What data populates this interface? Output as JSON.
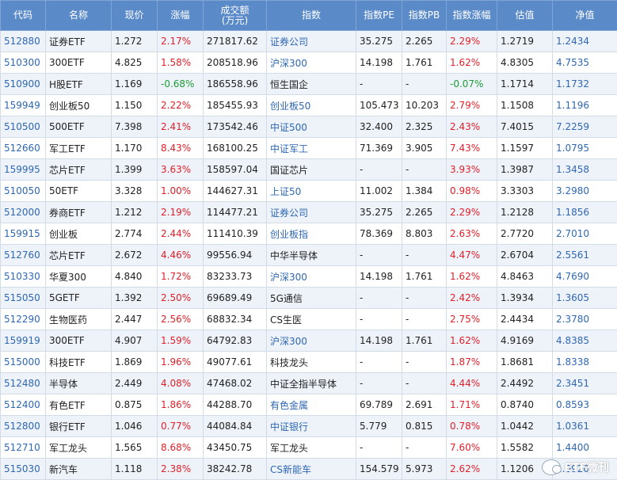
{
  "header": {
    "code": "代码",
    "name": "名称",
    "price": "现价",
    "change": "涨幅",
    "volume_line1": "成交额",
    "volume_line2": "(万元)",
    "index": "指数",
    "pe": "指数PE",
    "pb": "指数PB",
    "index_change": "指数涨幅",
    "estimate": "估值",
    "nav": "净值"
  },
  "rows": [
    {
      "code": "512880",
      "name": "证券ETF",
      "price": "1.272",
      "change": "2.17%",
      "dir": "up",
      "volume": "271817.62",
      "index": "证券公司",
      "index_link": true,
      "pe": "35.275",
      "pb": "2.265",
      "index_change": "2.29%",
      "index_dir": "up",
      "estimate": "1.2719",
      "nav": "1.2434"
    },
    {
      "code": "510300",
      "name": "300ETF",
      "price": "4.825",
      "change": "1.58%",
      "dir": "up",
      "volume": "208518.96",
      "index": "沪深300",
      "index_link": true,
      "pe": "14.198",
      "pb": "1.761",
      "index_change": "1.62%",
      "index_dir": "up",
      "estimate": "4.8305",
      "nav": "4.7535"
    },
    {
      "code": "510900",
      "name": "H股ETF",
      "price": "1.169",
      "change": "-0.68%",
      "dir": "down",
      "volume": "186558.96",
      "index": "恒生国企",
      "index_link": false,
      "pe": "-",
      "pb": "-",
      "index_change": "-0.07%",
      "index_dir": "down",
      "estimate": "1.1714",
      "nav": "1.1732"
    },
    {
      "code": "159949",
      "name": "创业板50",
      "price": "1.150",
      "change": "2.22%",
      "dir": "up",
      "volume": "185455.93",
      "index": "创业板50",
      "index_link": true,
      "pe": "105.473",
      "pb": "10.203",
      "index_change": "2.79%",
      "index_dir": "up",
      "estimate": "1.1508",
      "nav": "1.1196"
    },
    {
      "code": "510500",
      "name": "500ETF",
      "price": "7.398",
      "change": "2.41%",
      "dir": "up",
      "volume": "173542.46",
      "index": "中证500",
      "index_link": true,
      "pe": "32.400",
      "pb": "2.325",
      "index_change": "2.43%",
      "index_dir": "up",
      "estimate": "7.4015",
      "nav": "7.2259"
    },
    {
      "code": "512660",
      "name": "军工ETF",
      "price": "1.170",
      "change": "8.43%",
      "dir": "up",
      "volume": "168100.25",
      "index": "中证军工",
      "index_link": true,
      "pe": "71.369",
      "pb": "3.905",
      "index_change": "7.43%",
      "index_dir": "up",
      "estimate": "1.1597",
      "nav": "1.0795"
    },
    {
      "code": "159995",
      "name": "芯片ETF",
      "price": "1.399",
      "change": "3.63%",
      "dir": "up",
      "volume": "158597.04",
      "index": "国证芯片",
      "index_link": false,
      "pe": "-",
      "pb": "-",
      "index_change": "3.93%",
      "index_dir": "up",
      "estimate": "1.3987",
      "nav": "1.3458"
    },
    {
      "code": "510050",
      "name": "50ETF",
      "price": "3.328",
      "change": "1.00%",
      "dir": "up",
      "volume": "144627.31",
      "index": "上证50",
      "index_link": true,
      "pe": "11.002",
      "pb": "1.384",
      "index_change": "0.98%",
      "index_dir": "up",
      "estimate": "3.3303",
      "nav": "3.2980"
    },
    {
      "code": "512000",
      "name": "券商ETF",
      "price": "1.212",
      "change": "2.19%",
      "dir": "up",
      "volume": "114477.21",
      "index": "证券公司",
      "index_link": true,
      "pe": "35.275",
      "pb": "2.265",
      "index_change": "2.29%",
      "index_dir": "up",
      "estimate": "1.2128",
      "nav": "1.1856"
    },
    {
      "code": "159915",
      "name": "创业板",
      "price": "2.774",
      "change": "2.44%",
      "dir": "up",
      "volume": "111410.39",
      "index": "创业板指",
      "index_link": true,
      "pe": "78.369",
      "pb": "8.803",
      "index_change": "2.63%",
      "index_dir": "up",
      "estimate": "2.7720",
      "nav": "2.7010"
    },
    {
      "code": "512760",
      "name": "芯片ETF",
      "price": "2.672",
      "change": "4.46%",
      "dir": "up",
      "volume": "99556.94",
      "index": "中华半导体",
      "index_link": false,
      "pe": "-",
      "pb": "-",
      "index_change": "4.47%",
      "index_dir": "up",
      "estimate": "2.6704",
      "nav": "2.5561"
    },
    {
      "code": "510330",
      "name": "华夏300",
      "price": "4.840",
      "change": "1.72%",
      "dir": "up",
      "volume": "83233.73",
      "index": "沪深300",
      "index_link": true,
      "pe": "14.198",
      "pb": "1.761",
      "index_change": "1.62%",
      "index_dir": "up",
      "estimate": "4.8463",
      "nav": "4.7690"
    },
    {
      "code": "515050",
      "name": "5GETF",
      "price": "1.392",
      "change": "2.50%",
      "dir": "up",
      "volume": "69689.49",
      "index": "5G通信",
      "index_link": false,
      "pe": "-",
      "pb": "-",
      "index_change": "2.42%",
      "index_dir": "up",
      "estimate": "1.3934",
      "nav": "1.3605"
    },
    {
      "code": "512290",
      "name": "生物医药",
      "price": "2.447",
      "change": "2.56%",
      "dir": "up",
      "volume": "68832.34",
      "index": "CS生医",
      "index_link": false,
      "pe": "-",
      "pb": "-",
      "index_change": "2.75%",
      "index_dir": "up",
      "estimate": "2.4434",
      "nav": "2.3780"
    },
    {
      "code": "159919",
      "name": "300ETF",
      "price": "4.907",
      "change": "1.59%",
      "dir": "up",
      "volume": "64792.83",
      "index": "沪深300",
      "index_link": true,
      "pe": "14.198",
      "pb": "1.761",
      "index_change": "1.62%",
      "index_dir": "up",
      "estimate": "4.9169",
      "nav": "4.8385"
    },
    {
      "code": "515000",
      "name": "科技ETF",
      "price": "1.869",
      "change": "1.96%",
      "dir": "up",
      "volume": "49077.61",
      "index": "科技龙头",
      "index_link": false,
      "pe": "-",
      "pb": "-",
      "index_change": "1.87%",
      "index_dir": "up",
      "estimate": "1.8681",
      "nav": "1.8338"
    },
    {
      "code": "512480",
      "name": "半导体",
      "price": "2.449",
      "change": "4.08%",
      "dir": "up",
      "volume": "47468.02",
      "index": "中证全指半导体",
      "index_link": false,
      "pe": "-",
      "pb": "-",
      "index_change": "4.44%",
      "index_dir": "up",
      "estimate": "2.4492",
      "nav": "2.3451"
    },
    {
      "code": "512400",
      "name": "有色ETF",
      "price": "0.875",
      "change": "1.86%",
      "dir": "up",
      "volume": "44288.70",
      "index": "有色金属",
      "index_link": true,
      "pe": "69.789",
      "pb": "2.691",
      "index_change": "1.71%",
      "index_dir": "up",
      "estimate": "0.8740",
      "nav": "0.8593"
    },
    {
      "code": "512800",
      "name": "银行ETF",
      "price": "1.046",
      "change": "0.77%",
      "dir": "up",
      "volume": "44084.84",
      "index": "中证银行",
      "index_link": true,
      "pe": "5.779",
      "pb": "0.815",
      "index_change": "0.78%",
      "index_dir": "up",
      "estimate": "1.0442",
      "nav": "1.0361"
    },
    {
      "code": "512710",
      "name": "军工龙头",
      "price": "1.565",
      "change": "8.68%",
      "dir": "up",
      "volume": "43450.75",
      "index": "军工龙头",
      "index_link": false,
      "pe": "-",
      "pb": "-",
      "index_change": "7.60%",
      "index_dir": "up",
      "estimate": "1.5582",
      "nav": "1.4400"
    },
    {
      "code": "515030",
      "name": "新汽车",
      "price": "1.118",
      "change": "2.38%",
      "dir": "up",
      "volume": "38242.78",
      "index": "CS新能车",
      "index_link": true,
      "pe": "154.579",
      "pb": "5.973",
      "index_change": "2.62%",
      "index_dir": "up",
      "estimate": "1.1206",
      "nav": "1.0920"
    }
  ],
  "watermark": {
    "text": "ETF微刊",
    "icon": "wechat-icon"
  },
  "colors": {
    "header_bg": "#5b8ac9",
    "up": "#e0202a",
    "down": "#1f9a37",
    "link": "#2f67b1",
    "row_alt": "#eef3fa"
  }
}
